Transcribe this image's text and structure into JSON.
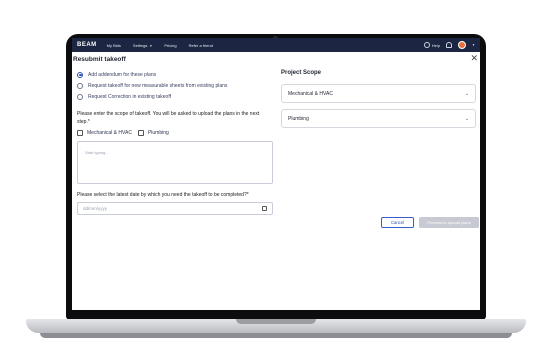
{
  "topbar": {
    "logo": "BEAM",
    "nav": [
      {
        "label": "My Bids"
      },
      {
        "label": "Settings"
      },
      {
        "label": "Pricing"
      },
      {
        "label": "Refer a friend"
      }
    ],
    "help_label": "Help",
    "colors": {
      "bar": "#1c2541",
      "avatar": "#e8703a"
    }
  },
  "dialog": {
    "title": "Resubmit takeoff",
    "options": [
      {
        "label": "Add addendum for these plans",
        "selected": true
      },
      {
        "label": "Request takeoff for new measurable sheets from existing plans",
        "selected": false
      },
      {
        "label": "Request Correction in existing takeoff",
        "selected": false
      }
    ],
    "scope_question": "Please enter the scope of takeoff. You will be asked to upload the plans in the next step.*",
    "checkboxes": [
      {
        "label": "Mechanical & HVAC",
        "checked": false
      },
      {
        "label": "Plumbing",
        "checked": false
      }
    ],
    "textarea_placeholder": "Start typing...",
    "date_question": "Please select the latest date by which you need the takeoff to be completed?*",
    "date_placeholder": "dd/mm/yyyy",
    "project_scope": {
      "title": "Project Scope",
      "sections": [
        {
          "label": "Mechanical & HVAC"
        },
        {
          "label": "Plumbing"
        }
      ]
    },
    "cancel_label": "Cancel",
    "proceed_label": "Proceed to upload plans",
    "accent_color": "#2f4fb7"
  }
}
